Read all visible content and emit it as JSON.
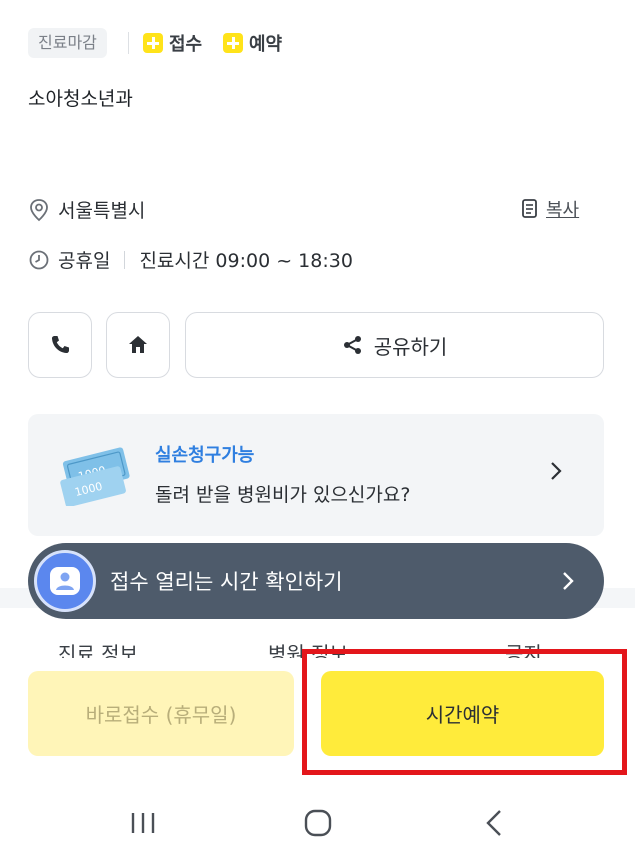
{
  "header": {
    "closed_badge": "진료마감",
    "tag_reception": "접수",
    "tag_reservation": "예약"
  },
  "department": "소아청소년과",
  "info": {
    "address": "서울특별시",
    "copy_label": "복사",
    "closed_day": "공휴일",
    "hours": "진료시간 09:00 ~ 18:30"
  },
  "actions": {
    "share_label": "공유하기"
  },
  "claim_card": {
    "title": "실손청구가능",
    "subtitle": "돌려 받을 병원비가 있으신가요?",
    "note_1000": "1000"
  },
  "banner": {
    "text": "접수 열리는 시간 확인하기"
  },
  "tabs": [
    "진료 정보",
    "병원 정보",
    "공지"
  ],
  "bottom": {
    "walkin_label": "바로접수 (휴무일)",
    "reserve_label": "시간예약"
  },
  "colors": {
    "accent_yellow": "#ffeb3b",
    "highlight_red": "#e3161b",
    "banner_bg": "#4e5b6b",
    "claim_blue": "#2f7fe0"
  }
}
